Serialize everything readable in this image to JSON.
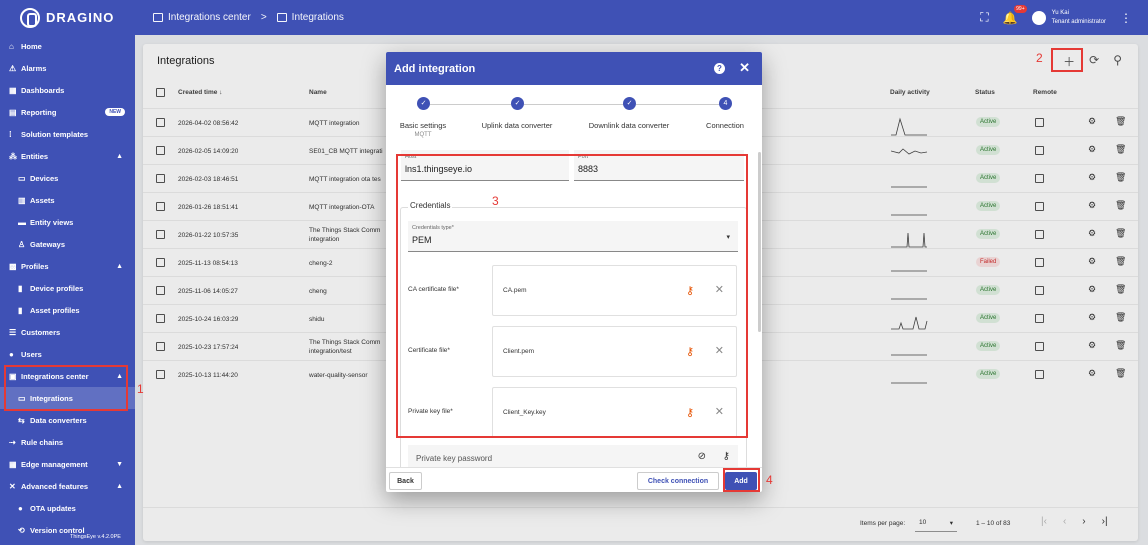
{
  "brand": {
    "name": "DRAGINO"
  },
  "breadcrumb": {
    "parent": "Integrations center",
    "separator": ">",
    "current": "Integrations"
  },
  "topbar": {
    "notification_count": "99+",
    "user_name": "Yu Kai",
    "user_role": "Tenant administrator"
  },
  "sidebar": {
    "items": [
      {
        "icon": "⌂",
        "label": "Home",
        "level": 0,
        "chev": ""
      },
      {
        "icon": "⚠",
        "label": "Alarms",
        "level": 0,
        "chev": ""
      },
      {
        "icon": "▦",
        "label": "Dashboards",
        "level": 0,
        "chev": ""
      },
      {
        "icon": "▤",
        "label": "Reporting",
        "level": 0,
        "chev": "",
        "badge": "NEW"
      },
      {
        "icon": "⁞",
        "label": "Solution templates",
        "level": 0,
        "chev": ""
      },
      {
        "icon": "⁂",
        "label": "Entities",
        "level": 0,
        "chev": "▲"
      },
      {
        "icon": "▭",
        "label": "Devices",
        "level": 1,
        "chev": ""
      },
      {
        "icon": "▥",
        "label": "Assets",
        "level": 1,
        "chev": ""
      },
      {
        "icon": "▬",
        "label": "Entity views",
        "level": 1,
        "chev": ""
      },
      {
        "icon": "♙",
        "label": "Gateways",
        "level": 1,
        "chev": ""
      },
      {
        "icon": "▩",
        "label": "Profiles",
        "level": 0,
        "chev": "▲"
      },
      {
        "icon": "▮",
        "label": "Device profiles",
        "level": 1,
        "chev": ""
      },
      {
        "icon": "▮",
        "label": "Asset profiles",
        "level": 1,
        "chev": ""
      },
      {
        "icon": "☰",
        "label": "Customers",
        "level": 0,
        "chev": ""
      },
      {
        "icon": "●",
        "label": "Users",
        "level": 0,
        "chev": ""
      },
      {
        "icon": "▣",
        "label": "Integrations center",
        "level": 0,
        "chev": "▲"
      },
      {
        "icon": "▭",
        "label": "Integrations",
        "level": 1,
        "chev": "",
        "active": true
      },
      {
        "icon": "⇆",
        "label": "Data converters",
        "level": 1,
        "chev": ""
      },
      {
        "icon": "⇢",
        "label": "Rule chains",
        "level": 0,
        "chev": ""
      },
      {
        "icon": "▦",
        "label": "Edge management",
        "level": 0,
        "chev": "▼"
      },
      {
        "icon": "✕",
        "label": "Advanced features",
        "level": 0,
        "chev": "▲"
      },
      {
        "icon": "●",
        "label": "OTA updates",
        "level": 1,
        "chev": ""
      },
      {
        "icon": "⟲",
        "label": "Version control",
        "level": 1,
        "chev": ""
      }
    ],
    "version": "ThingsEye v.4.2.0PE"
  },
  "annotations": {
    "one": "1",
    "two": "2",
    "three": "3",
    "four": "4"
  },
  "panel": {
    "title": "Integrations",
    "headers": {
      "created": "Created time ↓",
      "name": "Name",
      "daily": "Daily activity",
      "status": "Status",
      "remote": "Remote"
    },
    "rows": [
      {
        "created": "2026-04-02 08:56:42",
        "name": "MQTT integration",
        "status": "Active"
      },
      {
        "created": "2026-02-05 14:09:20",
        "name": "SE01_CB MQTT integrati",
        "status": "Active"
      },
      {
        "created": "2026-02-03 18:46:51",
        "name": "MQTT integration ota tes",
        "status": "Active"
      },
      {
        "created": "2026-01-26 18:51:41",
        "name": "MQTT integration-OTA",
        "status": "Active"
      },
      {
        "created": "2026-01-22 10:57:35",
        "name": "The Things Stack Comm",
        "name2": "integration",
        "status": "Active"
      },
      {
        "created": "2025-11-13 08:54:13",
        "name": "cheng-2",
        "status": "Failed"
      },
      {
        "created": "2025-11-06 14:05:27",
        "name": "cheng",
        "status": "Active"
      },
      {
        "created": "2025-10-24 16:03:29",
        "name": "shidu",
        "status": "Active"
      },
      {
        "created": "2025-10-23 17:57:24",
        "name": "The Things Stack Comm",
        "name2": "integration/test",
        "status": "Active"
      },
      {
        "created": "2025-10-13 11:44:20",
        "name": "water-quality-sensor",
        "status": "Active"
      }
    ],
    "footer": {
      "items_per_page_label": "Items per page:",
      "items_per_page": "10",
      "range": "1 – 10 of 83"
    }
  },
  "dialog": {
    "title": "Add integration",
    "steps": [
      {
        "label": "Basic settings",
        "sub": "MQTT",
        "num": "✓"
      },
      {
        "label": "Uplink data converter",
        "sub": "",
        "num": "✓"
      },
      {
        "label": "Downlink data converter",
        "sub": "",
        "num": "✓"
      },
      {
        "label": "Connection",
        "sub": "",
        "num": "4"
      }
    ],
    "host_label": "Host*",
    "host": "lns1.thingseye.io",
    "port_label": "Port*",
    "port": "8883",
    "credentials_legend": "Credentials",
    "cred_type_label": "Credentials type*",
    "cred_type": "PEM",
    "files": [
      {
        "label": "CA certificate file*",
        "file": "CA.pem"
      },
      {
        "label": "Certificate file*",
        "file": "Client.pem"
      },
      {
        "label": "Private key file*",
        "file": "Client_Key.key"
      }
    ],
    "password_label": "Private key password",
    "back": "Back",
    "check": "Check connection",
    "add": "Add"
  }
}
